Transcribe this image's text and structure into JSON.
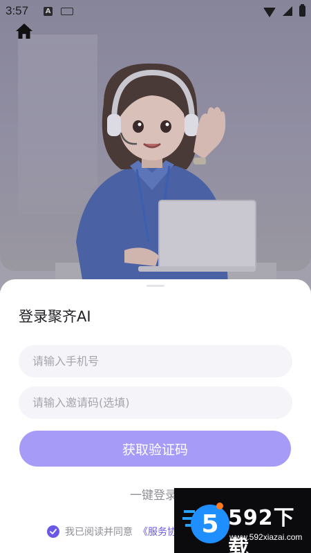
{
  "status_bar": {
    "time": "3:57",
    "input_badge": "A"
  },
  "icons": {
    "home": "home-icon",
    "wifi": "wifi-icon",
    "cell": "cell-signal-icon",
    "battery": "battery-icon",
    "check": "check-icon"
  },
  "colors": {
    "accent": "#6a58e6",
    "button": "#a69bf7",
    "input_bg": "#f5f5f9"
  },
  "login": {
    "title": "登录聚齐AI",
    "phone_placeholder": "请输入手机号",
    "invite_placeholder": "请输入邀请码(选填)",
    "get_code_button": "获取验证码",
    "one_key_login": "一键登录",
    "agreement_prefix": "我已阅读并同意",
    "agreement_link": "《服务协"
  },
  "watermark": {
    "site_name": "592下载",
    "url": "www.592xiazai.com"
  }
}
